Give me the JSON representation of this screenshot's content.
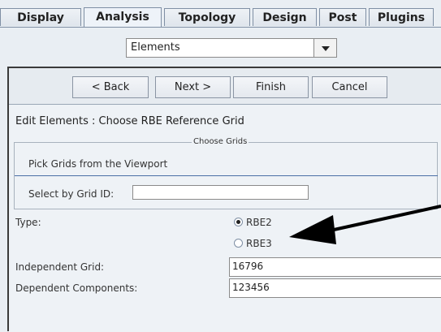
{
  "tabs": [
    {
      "label": "Display",
      "active": false
    },
    {
      "label": "Analysis",
      "active": true
    },
    {
      "label": "Topology",
      "active": false
    },
    {
      "label": "Design",
      "active": false
    },
    {
      "label": "Post",
      "active": false
    },
    {
      "label": "Plugins",
      "active": false
    }
  ],
  "dropdown": {
    "value": "Elements"
  },
  "wizard": {
    "back_label": "< Back",
    "next_label": "Next >",
    "finish_label": "Finish",
    "cancel_label": "Cancel"
  },
  "form": {
    "title": "Edit Elements : Choose RBE Reference Grid",
    "group_legend": "Choose Grids",
    "pick_text": "Pick Grids from the Viewport",
    "grid_id_label": "Select by Grid ID:",
    "grid_id_value": "",
    "type_label": "Type:",
    "type_options": [
      {
        "label": "RBE2",
        "selected": true
      },
      {
        "label": "RBE3",
        "selected": false
      }
    ],
    "independent_label": "Independent Grid:",
    "independent_value": "16796",
    "dependent_label": "Dependent Components:",
    "dependent_value": "123456"
  },
  "colors": {
    "annotation_arrow": "#000000",
    "separator": "#4a6fa5"
  }
}
